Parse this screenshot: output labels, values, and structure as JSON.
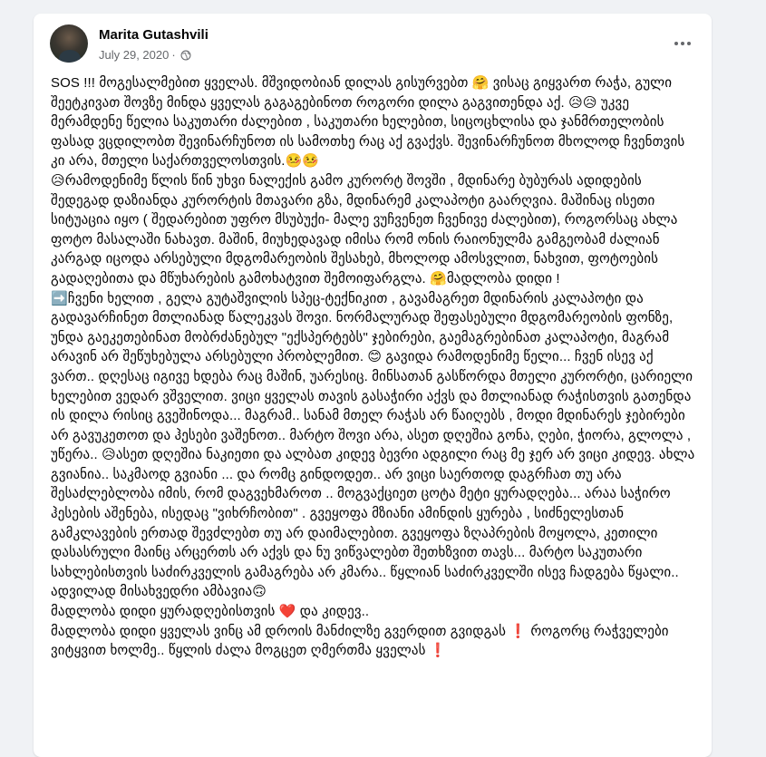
{
  "post": {
    "author": "Marita Gutashvili",
    "date": "July 29, 2020",
    "separator": "·",
    "privacy_icon": "globe-icon",
    "more_icon": "more-horizontal-icon",
    "paragraphs": [
      "SOS !!! მოგესალმებით ყველას. მშვიდობიან დილას გისურვებთ 🤗 ვისაც გიყვართ რაჭა, გული შეეტკივათ შოვზე მინდა ყველას გაგაგებინოთ როგორი დილა გაგვითენდა აქ. 😥😥 უკვე მერამდენე წელია საკუთარი ძალებით , საკუთარი ხელებით, სიცოცხლისა და ჯანმრთელობის ფასად ვცდილობთ შევინარჩუნოთ ის სამოთხე რაც აქ გვაქვს. შევინარჩუნოთ მხოლოდ ჩვენთვის კი არა, მთელი საქართველოსთვის.🤒🤒",
      "😥რამოდენიმე წლის წინ უხვი ნალექის გამო კურორტ შოვში , მდინარე ბუბურას ადიდების შედეგად დაზიანდა კურორტის მთავარი გზა, მდინარემ კალაპოტი გაარღვია. მაშინაც ისეთი სიტუაცია იყო ( შედარებით უფრო მსუბუქი- მალე ვუჩვენეთ ჩვენივე ძალებით), როგორსაც ახლა ფოტო მასალაში ნახავთ. მაშინ, მიუხედავად იმისა რომ ონის რაიონულმა გამგეობამ ძალიან კარგად იცოდა  არსებული მდგომარეობის შესახებ, მხოლოდ ამოსვლით, ნახვით, ფოტოების გადაღებითა და მწუხარების გამოხატვით შემოიფარგლა. 🤗მადლობა დიდი !",
      "➡️ჩვენი ხელით , გელა გუტაშვილის სპეც-ტექნიკით  , გავამაგრეთ მდინარის კალაპოტი და გადავარჩინეთ მთლიანად წალეკვას შოვი. ნორმალურად შეფასებული მდგომარეობის ფონზე, უნდა გაეკეთებინათ მობრძანებულ \"ექსპერტებს\" ჯებირები, გაემაგრებინათ კალაპოტი, მაგრამ არავინ არ შეწუხებულა არსებული პრობლემით. 😊 გავიდა რამოდენიმე წელი...  ჩვენ ისევ აქ ვართ.. დღესაც იგივე ხდება რაც მაშინ, უარესიც.  მინსათან გასწორდა მთელი კურორტი, ცარიელი ხელებით ვედარ ვშველით. ვიცი ყველას თავის გასაჭირი აქვს და მთლიანად რაჭისთვის გათენდა ის დილა რისიც გვეშინოდა... მაგრამ.. სანამ მთელ რაჭას არ წაიღებს , მოდი მდინარეს ჯებირები არ გავუკეთოთ და ჰესები ვაშენოთ.. მარტო შოვი არა, ასეთ დღეშია გონა, ღები, ჭიორა, გლოლა , უწერა.. 😥ასეთ დღეშია ნაკიეთი და ალბათ კიდევ ბევრი ადგილი რაც მე ჯერ არ ვიცი კიდევ.  ახლა გვიანია.. საკმაოდ გვიანი ... და რომც გინდოდეთ.. არ ვიცი საერთოდ დაგრჩათ თუ არა შესაძლებლობა იმის, რომ დაგვეხმაროთ .. მოგვაქციეთ ცოტა მეტი ყურადღება... არაა საჭირო ჰესების აშენება, ისედაც \"ვიხრჩობით\" .  გვეყოფა მზიანი ამინდის ყურება , სიძნელესთან გამკლავების ერთად შევძლებთ თუ არ დაიმალებით. გვეყოფა ზღაპრების მოყოლა, კეთილი დასასრული მაინც არცერთს არ აქვს  და  ნუ ვიწვალებთ შეთხზვით თავს... მარტო საკუთარი სახლებისთვის საძირკველის გამაგრება არ კმარა.. წყლიან საძირკველში ისევ ჩადგება წყალი.. ადვილად მისახვედრი ამბავია🙃",
      " მადლობა დიდი ყურადღებისთვის ❤️ და კიდევ..",
      "მადლობა დიდი ყველას ვინც ამ დროის მანძილზე გვერდით გვიდგას ❗ როგორც რაჭველები ვიტყვით ხოლმე.. წყლის ძალა მოგცეთ ღმერთმა ყველას ❗"
    ]
  },
  "colors": {
    "background": "#f0f2f5",
    "card": "#ffffff",
    "primary_text": "#050505",
    "secondary_text": "#65676b"
  }
}
